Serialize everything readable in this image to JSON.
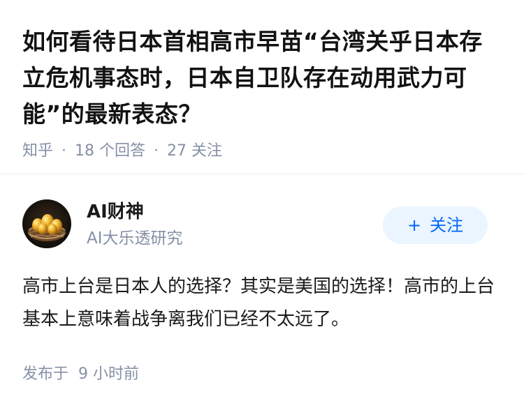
{
  "question": {
    "title": "如何看待日本首相高市早苗“台湾关乎日本存立危机事态时，日本自卫队存在动用武力可能”的最新表态？",
    "source": "知乎",
    "answer_count": "18",
    "answer_unit": "个回答",
    "follower_count": "27",
    "follower_unit": "关注"
  },
  "author": {
    "name": "AI财神",
    "bio": "AI大乐透研究",
    "avatar_icon": "golden-eggs-nest-icon",
    "follow_label": "关注"
  },
  "answer": {
    "content": "高市上台是日本人的选择？其实是美国的选择！高市的上台基本上意味着战争离我们已经不太远了。",
    "published_label": "发布于",
    "published_time": "9 小时前"
  },
  "colors": {
    "accent": "#0066ff",
    "follow_bg": "#ebf5ff",
    "meta_text": "#8590a6",
    "title_text": "#121212"
  }
}
